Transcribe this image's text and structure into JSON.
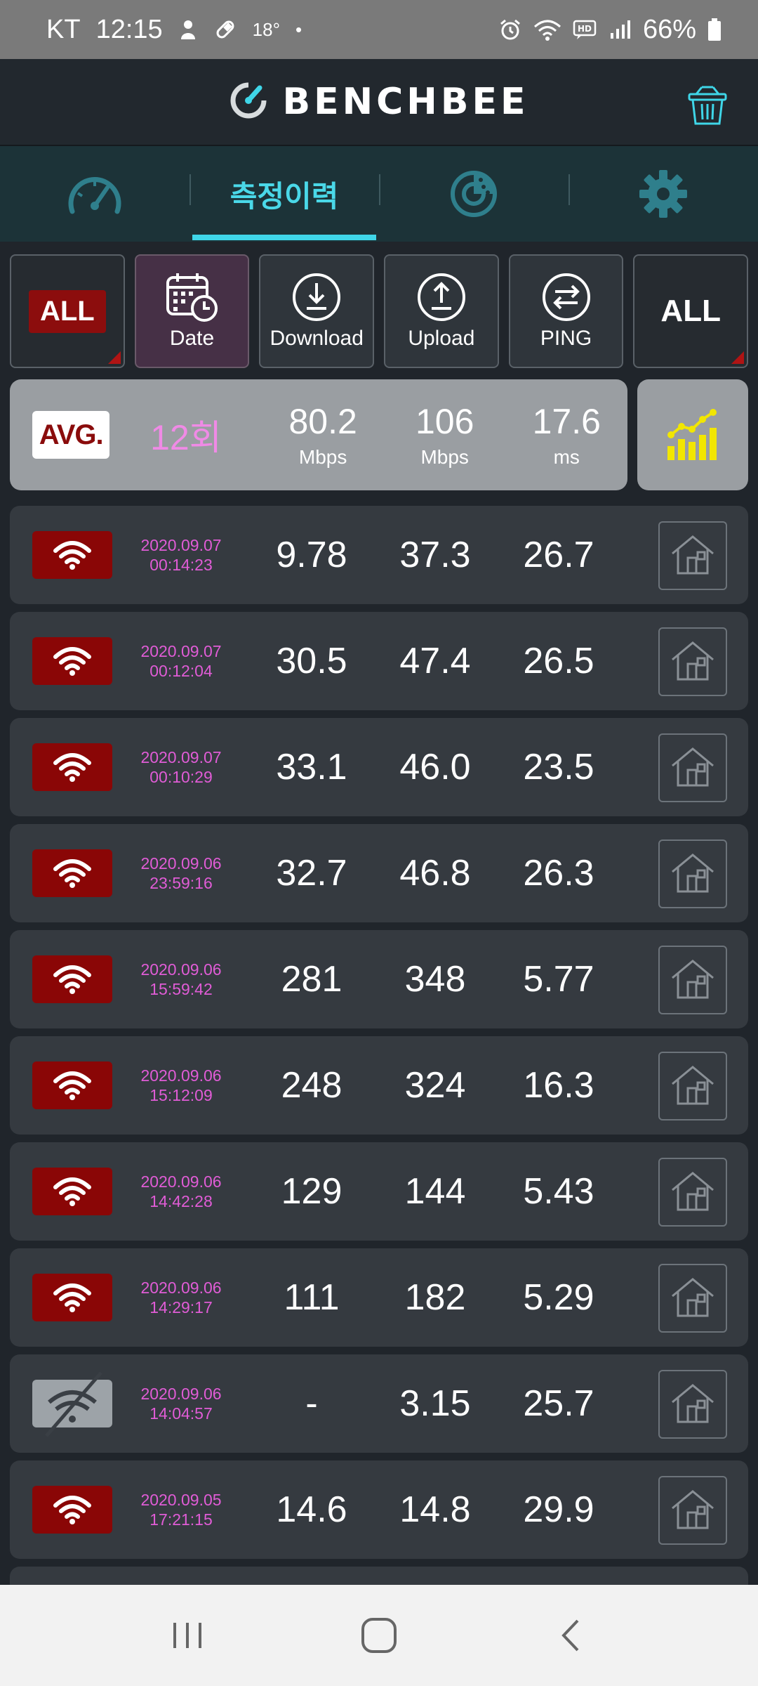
{
  "status_bar": {
    "carrier": "KT",
    "time": "12:15",
    "temperature": "18°",
    "dot": "•",
    "battery_percent": "66%"
  },
  "header": {
    "brand": "BENCHBEE",
    "icons": {
      "logo": "speed-gauge-logo",
      "trash": "trash-can-icon"
    }
  },
  "tabs": [
    {
      "id": "speedometer",
      "icon": "speedometer-icon",
      "label": ""
    },
    {
      "id": "history",
      "label": "측정이력",
      "active": true
    },
    {
      "id": "coverage",
      "icon": "coverage-map-icon",
      "label": ""
    },
    {
      "id": "settings",
      "icon": "gear-icon",
      "label": ""
    }
  ],
  "filters": {
    "network_all": "ALL",
    "date": "Date",
    "download": "Download",
    "upload": "Upload",
    "ping": "PING",
    "location_all": "ALL"
  },
  "summary": {
    "badge": "AVG.",
    "count": "12회",
    "download": {
      "value": "80.2",
      "unit": "Mbps"
    },
    "upload": {
      "value": "106",
      "unit": "Mbps"
    },
    "ping": {
      "value": "17.6",
      "unit": "ms"
    }
  },
  "records": [
    {
      "network": "wifi",
      "date": "2020.09.07",
      "time": "00:14:23",
      "download": "9.78",
      "upload": "37.3",
      "ping": "26.7"
    },
    {
      "network": "wifi",
      "date": "2020.09.07",
      "time": "00:12:04",
      "download": "30.5",
      "upload": "47.4",
      "ping": "26.5"
    },
    {
      "network": "wifi",
      "date": "2020.09.07",
      "time": "00:10:29",
      "download": "33.1",
      "upload": "46.0",
      "ping": "23.5"
    },
    {
      "network": "wifi",
      "date": "2020.09.06",
      "time": "23:59:16",
      "download": "32.7",
      "upload": "46.8",
      "ping": "26.3"
    },
    {
      "network": "wifi",
      "date": "2020.09.06",
      "time": "15:59:42",
      "download": "281",
      "upload": "348",
      "ping": "5.77"
    },
    {
      "network": "wifi",
      "date": "2020.09.06",
      "time": "15:12:09",
      "download": "248",
      "upload": "324",
      "ping": "16.3"
    },
    {
      "network": "wifi",
      "date": "2020.09.06",
      "time": "14:42:28",
      "download": "129",
      "upload": "144",
      "ping": "5.43"
    },
    {
      "network": "wifi",
      "date": "2020.09.06",
      "time": "14:29:17",
      "download": "111",
      "upload": "182",
      "ping": "5.29"
    },
    {
      "network": "wifi-off",
      "date": "2020.09.06",
      "time": "14:04:57",
      "download": "-",
      "upload": "3.15",
      "ping": "25.7"
    },
    {
      "network": "wifi",
      "date": "2020.09.05",
      "time": "17:21:15",
      "download": "14.6",
      "upload": "14.8",
      "ping": "29.9"
    }
  ],
  "colors": {
    "accent_cyan": "#3fd6e8",
    "badge_red": "#8a0606",
    "date_magenta": "#e05cd6",
    "count_pink": "#f08ae6",
    "chart_yellow": "#f2e600"
  }
}
